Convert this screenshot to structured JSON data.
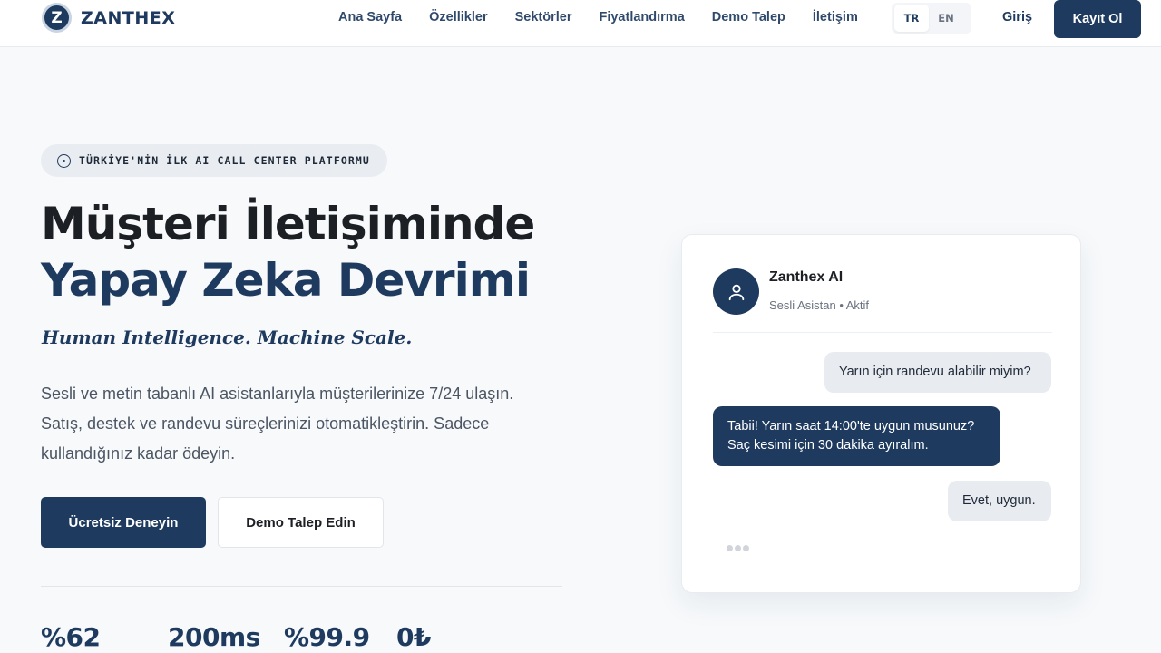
{
  "brand": {
    "logo_letter": "Z",
    "name": "ZANTHEX"
  },
  "nav": {
    "links": [
      "Ana Sayfa",
      "Özellikler",
      "Sektörler",
      "Fiyatlandırma",
      "Demo Talep",
      "İletişim"
    ],
    "lang": {
      "tr": "TR",
      "en": "EN",
      "active": "TR"
    },
    "login": "Giriş",
    "signup": "Kayıt Ol"
  },
  "hero": {
    "badge": "TÜRKİYE'NİN İLK AI CALL CENTER PLATFORMU",
    "title_line1": "Müşteri İletişiminde",
    "title_line2": "Yapay Zeka Devrimi",
    "tagline": "Human Intelligence. Machine Scale.",
    "description": "Sesli ve metin tabanlı AI asistanlarıyla müşterilerinize 7/24 ulaşın. Satış, destek ve randevu süreçlerinizi otomatikleştirin. Sadece kullandığınız kadar ödeyin.",
    "cta_primary": "Ücretsiz Deneyin",
    "cta_secondary": "Demo Talep Edin"
  },
  "stats": [
    "%62",
    "200ms",
    "%99.9",
    "0₺"
  ],
  "chat": {
    "name": "Zanthex AI",
    "status": "Sesli Asistan • Aktif",
    "messages": [
      {
        "role": "user",
        "text": "Yarın için randevu alabilir miyim?"
      },
      {
        "role": "ai",
        "text": "Tabii! Yarın saat 14:00'te uygun musunuz? Saç kesimi için 30 dakika ayıralım."
      },
      {
        "role": "user",
        "text": "Evet, uygun."
      }
    ]
  },
  "colors": {
    "primary": "#1e3a5f",
    "background": "#f7f9fb",
    "bubble_user": "#e8ecf1"
  }
}
